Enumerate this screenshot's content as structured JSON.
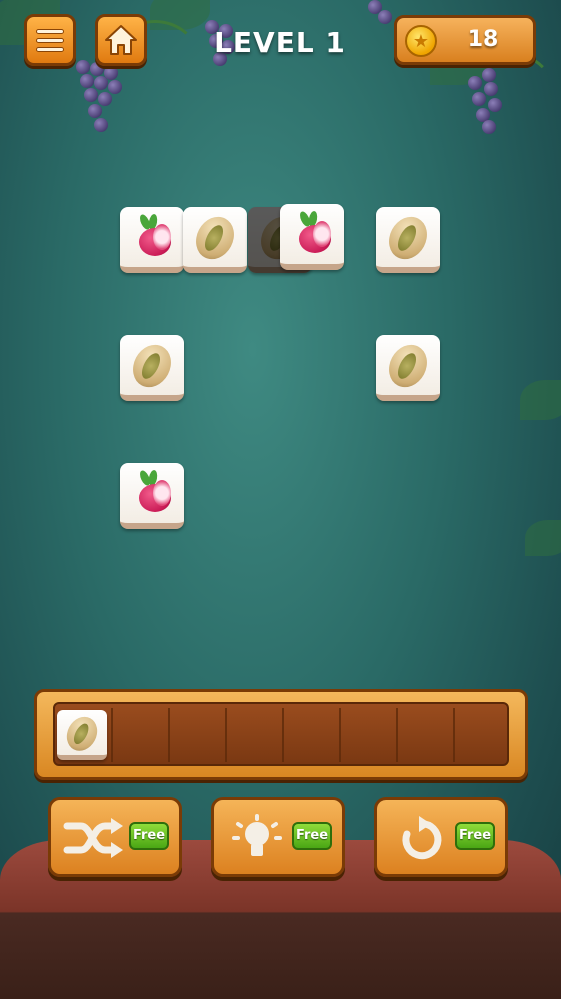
{
  "header": {
    "level_title": "LEVEL 1",
    "coins": "18",
    "menu_icon": "hamburger-menu-icon",
    "home_icon": "home-icon",
    "coin_icon": "gold-coin-icon"
  },
  "board": {
    "tiles": [
      {
        "item": "radish",
        "state": "active"
      },
      {
        "item": "pistachio",
        "state": "active"
      },
      {
        "item": "pistachio",
        "state": "covered"
      },
      {
        "item": "radish",
        "state": "active"
      },
      {
        "item": "pistachio",
        "state": "active"
      },
      {
        "item": "pistachio",
        "state": "active"
      },
      {
        "item": "pistachio",
        "state": "active"
      },
      {
        "item": "radish",
        "state": "active"
      }
    ]
  },
  "tray": {
    "capacity": 7,
    "items": [
      "pistachio"
    ]
  },
  "powerups": [
    {
      "name": "shuffle",
      "icon": "shuffle-icon",
      "badge": "Free"
    },
    {
      "name": "hint",
      "icon": "lightbulb-icon",
      "badge": "Free"
    },
    {
      "name": "undo",
      "icon": "undo-icon",
      "badge": "Free"
    }
  ],
  "colors": {
    "button_orange": "#e88a1c",
    "badge_green": "#5cb81f",
    "background_teal": "#2a6a66"
  }
}
